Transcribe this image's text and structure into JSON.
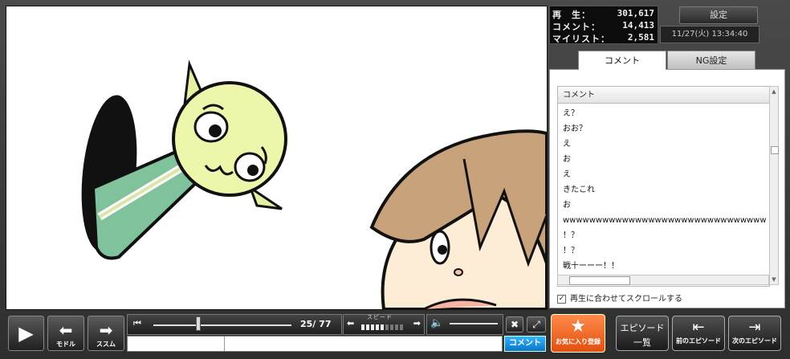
{
  "stats": {
    "play_label": "再　生：",
    "play_value": "301,617",
    "comment_label": "コメント：",
    "comment_value": "14,413",
    "mylist_label": "マイリスト：",
    "mylist_value": "2,581"
  },
  "settings_label": "設定",
  "datetime": "11/27(火) 13:34:40",
  "tabs": {
    "comment": "コメント",
    "ng": "NG設定"
  },
  "comment_list": {
    "header": "コメント",
    "rows": [
      "え？",
      "おお？",
      "え",
      "お",
      "え",
      "きたこれ",
      "お",
      "wwwwwwwwwwwwwwwwwwwwwwwwwwwwwwww",
      "！？",
      "！？",
      "戦十ーーー！！"
    ]
  },
  "autoscroll_label": "再生に合わせてスクロールする",
  "controls": {
    "back_label": "モドル",
    "forward_label": "ススム",
    "position": "25/",
    "total": "77",
    "speed_label": "スピード",
    "comment_button": "コメント"
  },
  "favorite_label": "お気に入り登録",
  "episodes": {
    "list_label_1": "エピソード",
    "list_label_2": "一覧",
    "prev_label": "前のエピソード",
    "next_label": "次のエピソード"
  },
  "colors": {
    "accent_orange": "#e25a1c",
    "accent_blue": "#1a90e0"
  }
}
